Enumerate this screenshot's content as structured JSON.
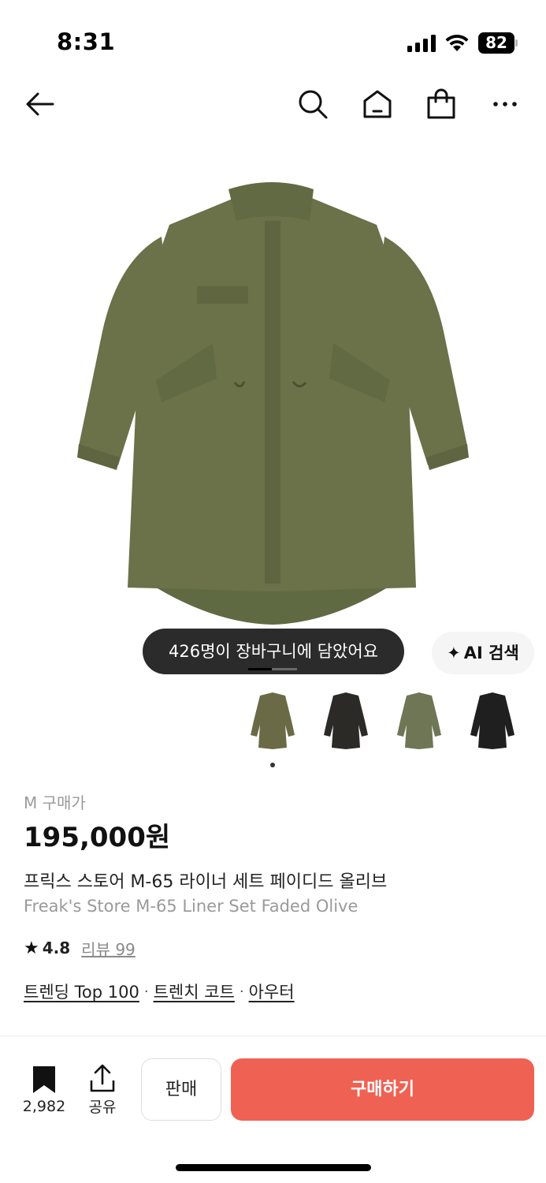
{
  "status_bar": {
    "time": "8:31",
    "battery": "82",
    "icons": [
      "signal-icon",
      "wifi-icon",
      "battery-icon"
    ]
  },
  "nav": {
    "icons": [
      "back-arrow-icon",
      "search-icon",
      "home-icon",
      "shopping-bag-icon",
      "more-icon"
    ]
  },
  "product_image": {
    "toast": "426명이 장바구니에 담았어요",
    "ai_search_label": "AI 검색",
    "ai_search_icon": "sparkle-icon"
  },
  "thumbnails": [
    {
      "color": "#6a6b46"
    },
    {
      "color": "#2b2a27"
    },
    {
      "color": "#6f7655"
    },
    {
      "color": "#1f1f1f"
    }
  ],
  "product": {
    "size_label": "M 구매가",
    "price": "195,000원",
    "title_ko": "프릭스 스토어 M-65 라이너 세트 페이디드 올리브",
    "title_en": "Freak's Store M-65 Liner Set Faded Olive",
    "rating": "4.8",
    "reviews": "리뷰 99",
    "tags": [
      "트렌딩 Top 100",
      "트렌치 코트",
      "아우터"
    ],
    "tag_separator": "·"
  },
  "bottom_bar": {
    "bookmark_count": "2,982",
    "share_label": "공유",
    "sell_label": "판매",
    "buy_label": "구매하기",
    "buy_color": "#ef6253"
  }
}
